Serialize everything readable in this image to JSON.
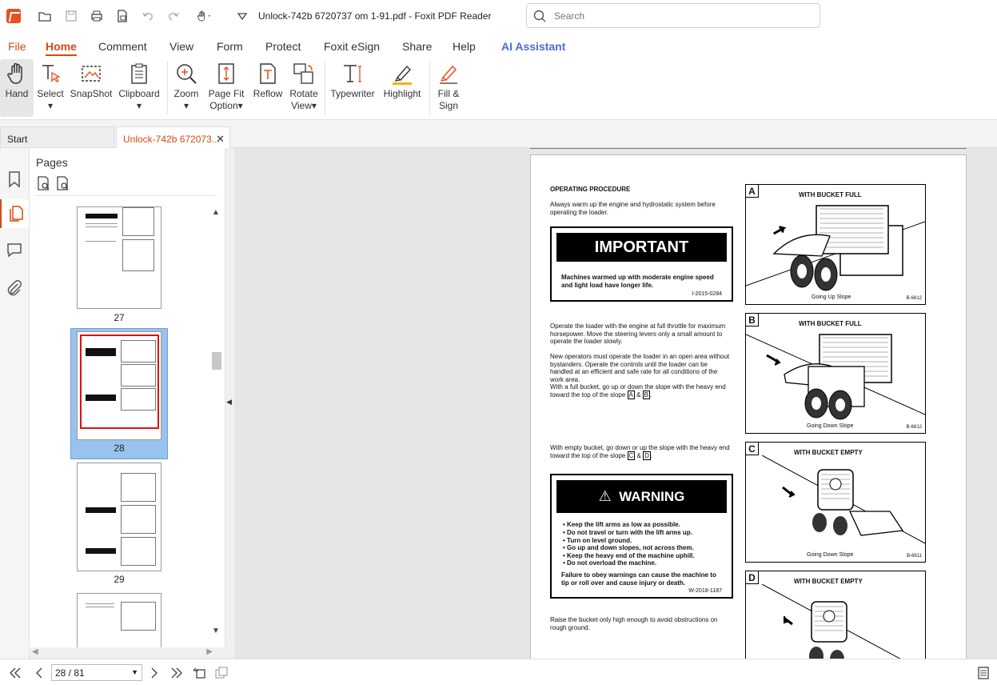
{
  "window": {
    "title": "Unlock-742b 6720737 om 1-91.pdf - Foxit PDF Reader"
  },
  "search": {
    "placeholder": "Search"
  },
  "menu": [
    "File",
    "Home",
    "Comment",
    "View",
    "Form",
    "Protect",
    "Foxit eSign",
    "Share",
    "Help",
    "AI Assistant"
  ],
  "ribbon": {
    "hand": "Hand",
    "select": "Select",
    "snapshot": "SnapShot",
    "clipboard": "Clipboard",
    "zoom": "Zoom",
    "pagefit1": "Page Fit",
    "pagefit2": "Option",
    "reflow": "Reflow",
    "rotate1": "Rotate",
    "rotate2": "View",
    "typewriter": "Typewriter",
    "highlight": "Highlight",
    "fill1": "Fill &",
    "fill2": "Sign"
  },
  "tabs": {
    "start": "Start",
    "doc": "Unlock-742b 672073...",
    "close": "✕"
  },
  "panel": {
    "title": "Pages",
    "thumbs": [
      "27",
      "28",
      "29"
    ]
  },
  "status": {
    "page": "28 / 81"
  },
  "document": {
    "heading": "OPERATING PROCEDURE",
    "p1": "Always warm up the engine and hydrostatic system before operating the loader.",
    "important_title": "IMPORTANT",
    "important_text": "Machines warmed up with moderate engine speed and light load have longer life.",
    "important_code": "I-2015-0284",
    "p2": "Operate the loader with the engine at full throttle for maximum horsepower. Move the steering levers only a small amount to operate the loader slowly.",
    "p3": "New operators must operate the loader in an open area without bystanders. Operate the controls until the loader can be handled at an efficient and safe rate for all conditions of the work area.",
    "p4": "With a full bucket, go up or down the slope with the heavy end toward the top of the slope",
    "p4_refs": [
      "A",
      "B"
    ],
    "p5": "With empty bucket, go down or up the slope with the heavy end toward the top of the slope",
    "p5_refs": [
      "C",
      "D"
    ],
    "warning_title": "WARNING",
    "warning_items": [
      "Keep the lift arms as low as possible.",
      "Do not travel or turn with the lift arms up.",
      "Turn on level ground.",
      "Go up and down slopes, not across them.",
      "Keep the heavy end of the machine uphill.",
      "Do not overload the machine."
    ],
    "warning_text": "Failure to obey warnings can cause the machine to tip or roll over and cause injury or death.",
    "warning_code": "W-2018-1187",
    "p6": "Raise the bucket only high enough to avoid obstructions on rough ground.",
    "figures": [
      {
        "label": "A",
        "title": "WITH BUCKET FULL",
        "caption": "Going Up Slope",
        "code": "B-6612"
      },
      {
        "label": "B",
        "title": "WITH BUCKET FULL",
        "caption": "Going Down Slope",
        "code": "B-6612"
      },
      {
        "label": "C",
        "title": "WITH BUCKET EMPTY",
        "caption": "Going Down Slope",
        "code": "B-6611"
      },
      {
        "label": "D",
        "title": "WITH BUCKET EMPTY",
        "caption": "",
        "code": ""
      }
    ]
  }
}
